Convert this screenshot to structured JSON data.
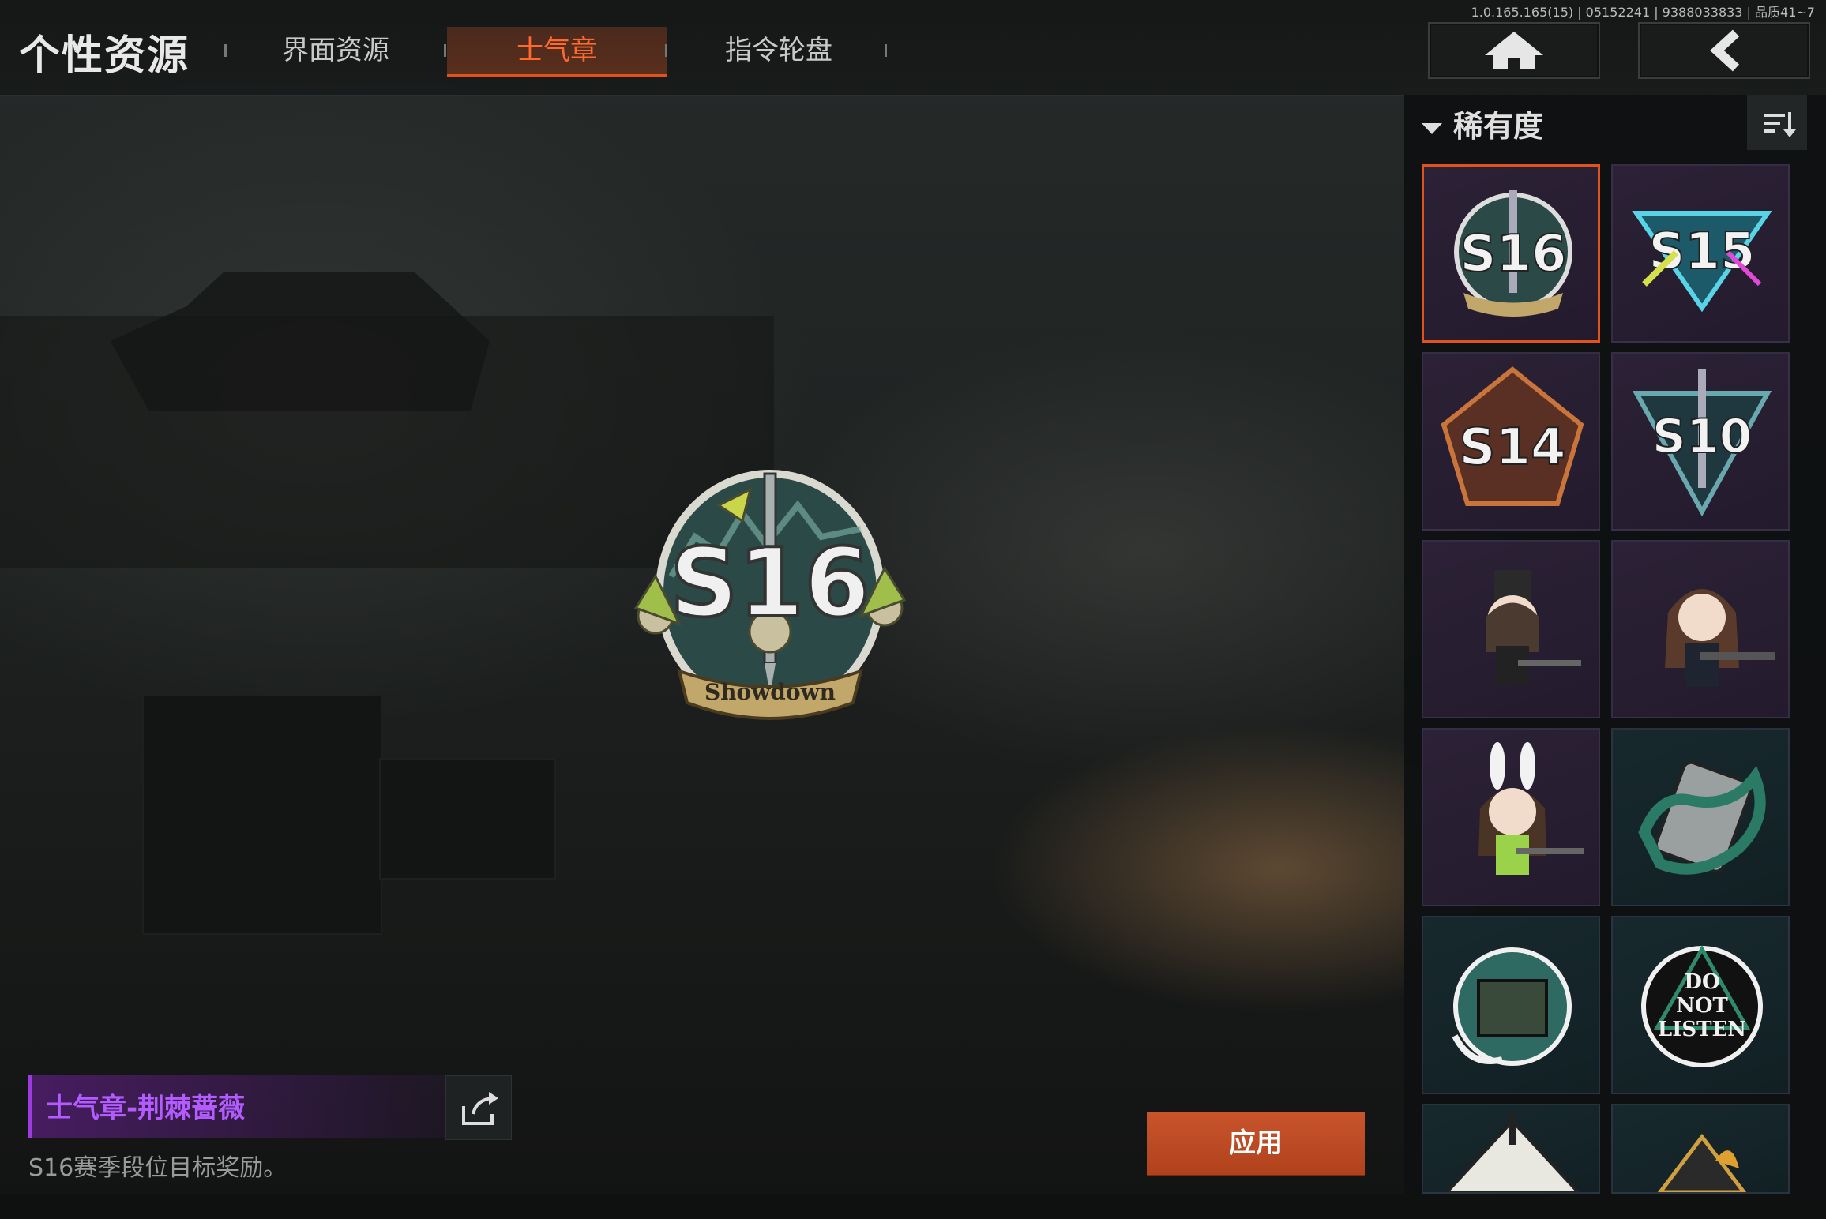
{
  "header": {
    "title": "个性资源",
    "tabs": [
      {
        "label": "界面资源",
        "active": false
      },
      {
        "label": "士气章",
        "active": true
      },
      {
        "label": "指令轮盘",
        "active": false
      }
    ],
    "home_icon": "home-icon",
    "back_icon": "back-arrow-icon",
    "version_text": "1.0.165.165(15) | 05152241 | 9388033833 | 品质41~7"
  },
  "panel": {
    "sort_label": "稀有度",
    "sort_icon": "sort-icon",
    "badges": [
      {
        "name": "S16",
        "rarity": "purple",
        "selected": true
      },
      {
        "name": "S15",
        "rarity": "purple",
        "selected": false
      },
      {
        "name": "S14",
        "rarity": "purple",
        "selected": false
      },
      {
        "name": "S10",
        "rarity": "purple",
        "selected": false
      },
      {
        "name": "chibi-officer",
        "rarity": "purple",
        "selected": false
      },
      {
        "name": "chibi-girl-rifle",
        "rarity": "purple",
        "selected": false
      },
      {
        "name": "chibi-bunny",
        "rarity": "purple",
        "selected": false
      },
      {
        "name": "tentacle-gear",
        "rarity": "teal",
        "selected": false
      },
      {
        "name": "tentacle-tank",
        "rarity": "teal",
        "selected": false
      },
      {
        "name": "do-not-listen",
        "rarity": "teal",
        "selected": false,
        "text": "DO NOT LISTEN"
      },
      {
        "name": "partial-1",
        "rarity": "teal",
        "selected": false
      },
      {
        "name": "partial-2",
        "rarity": "teal",
        "selected": false
      }
    ]
  },
  "preview": {
    "badge_text": "S16",
    "banner_text": "Showdown"
  },
  "item": {
    "name": "士气章-荆棘蔷薇",
    "description": "S16赛季段位目标奖励。",
    "share_icon": "share-icon"
  },
  "apply_label": "应用",
  "colors": {
    "accent": "#e0531e",
    "purple_name": "#b25cff",
    "apply_button": "#c0491f"
  }
}
